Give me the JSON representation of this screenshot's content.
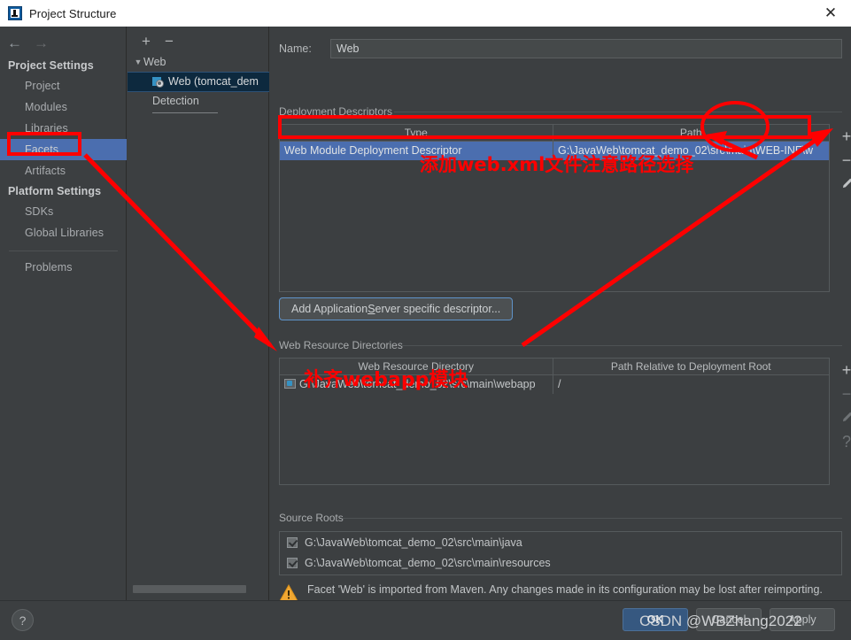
{
  "window": {
    "title": "Project Structure",
    "icon": "intellij-idea-icon",
    "close_label": "✕"
  },
  "sidebar": {
    "back_icon": "←",
    "forward_icon": "→",
    "groups": [
      {
        "label": "Project Settings",
        "items": [
          {
            "label": "Project",
            "selected": false
          },
          {
            "label": "Modules",
            "selected": false
          },
          {
            "label": "Libraries",
            "selected": false
          },
          {
            "label": "Facets",
            "selected": true
          },
          {
            "label": "Artifacts",
            "selected": false
          }
        ]
      },
      {
        "label": "Platform Settings",
        "items": [
          {
            "label": "SDKs",
            "selected": false
          },
          {
            "label": "Global Libraries",
            "selected": false
          }
        ]
      }
    ],
    "problems": {
      "label": "Problems"
    }
  },
  "tree": {
    "add_label": "+",
    "remove_label": "−",
    "root": {
      "label": "Web",
      "expander": "▼"
    },
    "child": {
      "label": "Web (tomcat_dem",
      "icon": "web-facet-icon"
    },
    "detection": {
      "label": "Detection"
    }
  },
  "main": {
    "name_label": "Name:",
    "name_value": "Web",
    "deployment": {
      "group_label": "Deployment Descriptors",
      "columns": [
        "Type",
        "Path"
      ],
      "rows": [
        {
          "type": "Web Module Deployment Descriptor",
          "path": "G:\\JavaWeb\\tomcat_demo_02\\src\\main\\WEB-INF\\w",
          "selected": true
        }
      ],
      "toolbar": [
        {
          "icon": "plus-icon",
          "label": "+",
          "enabled": true
        },
        {
          "icon": "minus-icon",
          "label": "−",
          "enabled": true
        },
        {
          "icon": "pencil-icon",
          "label": "",
          "enabled": true
        }
      ]
    },
    "add_descriptor_button": {
      "prefix": "Add Application ",
      "mnemonic": "S",
      "suffix": "erver specific descriptor..."
    },
    "web_resources": {
      "group_label": "Web Resource Directories",
      "columns": [
        "Web Resource Directory",
        "Path Relative to Deployment Root"
      ],
      "rows": [
        {
          "directory": "G:\\JavaWeb\\tomcat_demo_02\\src\\main\\webapp",
          "relative": "/"
        }
      ],
      "toolbar": [
        {
          "icon": "plus-icon",
          "label": "+",
          "enabled": true
        },
        {
          "icon": "minus-icon",
          "label": "−",
          "enabled": false
        },
        {
          "icon": "pencil-icon",
          "label": "",
          "enabled": false
        },
        {
          "icon": "question-icon",
          "label": "?",
          "enabled": false
        }
      ]
    },
    "source_roots": {
      "group_label": "Source Roots",
      "items": [
        {
          "label": "G:\\JavaWeb\\tomcat_demo_02\\src\\main\\java",
          "checked": true
        },
        {
          "label": "G:\\JavaWeb\\tomcat_demo_02\\src\\main\\resources",
          "checked": true
        }
      ]
    },
    "warning": {
      "icon": "warning-triangle-icon",
      "text": "Facet 'Web' is imported from Maven. Any changes made in its configuration may be lost after reimporting."
    }
  },
  "footer": {
    "help_label": "?",
    "ok_label": "OK",
    "cancel_label": "Cancel",
    "apply_label": "Apply"
  },
  "annotations": {
    "color": "#ff0000",
    "note_descriptor": "添加web.xml文件注意路径选择",
    "note_webapp": "补齐webapp模块"
  },
  "watermark": {
    "text": "CSDN @WBZhang2022"
  }
}
